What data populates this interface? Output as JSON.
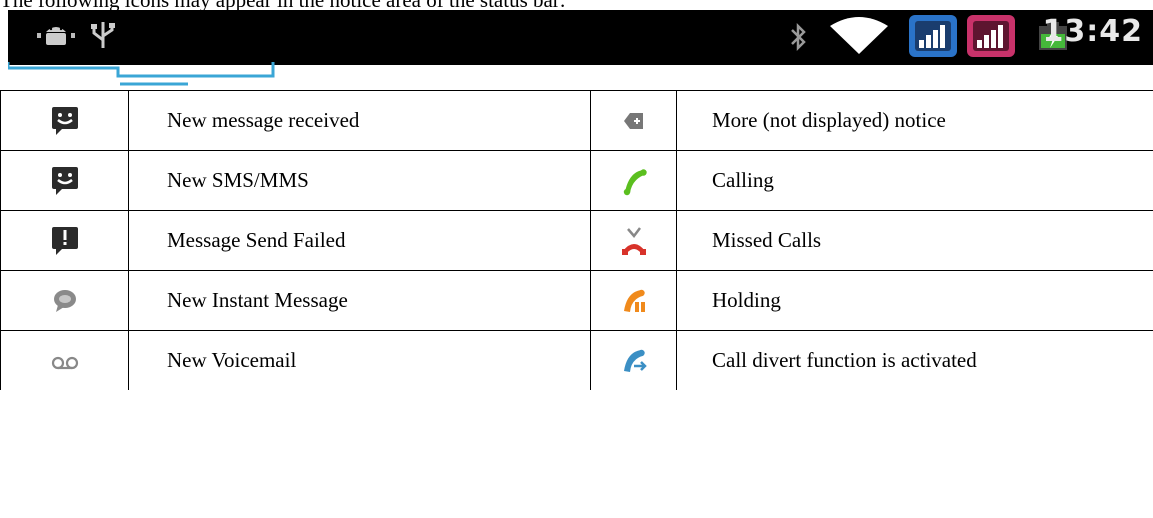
{
  "intro": "The following icons may appear in the notice area of the status bar:",
  "status_bar": {
    "time": "13:42",
    "left_icons": [
      "android-debug-icon",
      "usb-icon"
    ],
    "right_icons": [
      "bluetooth-icon",
      "wifi-icon",
      "signal-sim1-icon",
      "signal-sim2-icon",
      "battery-charging-icon"
    ]
  },
  "rows": [
    {
      "left_icon": "message-smiley-icon",
      "left_label": "New message received",
      "right_icon": "more-notice-icon",
      "right_label": "More (not displayed) notice"
    },
    {
      "left_icon": "message-smiley-icon",
      "left_label": "New SMS/MMS",
      "right_icon": "calling-icon",
      "right_label": "Calling"
    },
    {
      "left_icon": "message-failed-icon",
      "left_label": "Message Send Failed",
      "right_icon": "missed-call-icon",
      "right_label": "Missed Calls"
    },
    {
      "left_icon": "instant-message-icon",
      "left_label": "New Instant Message",
      "right_icon": "holding-call-icon",
      "right_label": "Holding"
    },
    {
      "left_icon": "voicemail-icon",
      "left_label": "New Voicemail",
      "right_icon": "call-divert-icon",
      "right_label": "Call divert function is activated"
    }
  ],
  "colors": {
    "status_bar_bg": "#000000",
    "tab_line": "#3aa6d6",
    "sim1": "#2a73c8",
    "sim2": "#c8326a",
    "calling": "#5bbf1f",
    "missed": "#d8322a",
    "holding": "#f08a1c",
    "divert": "#3b8fc4"
  }
}
